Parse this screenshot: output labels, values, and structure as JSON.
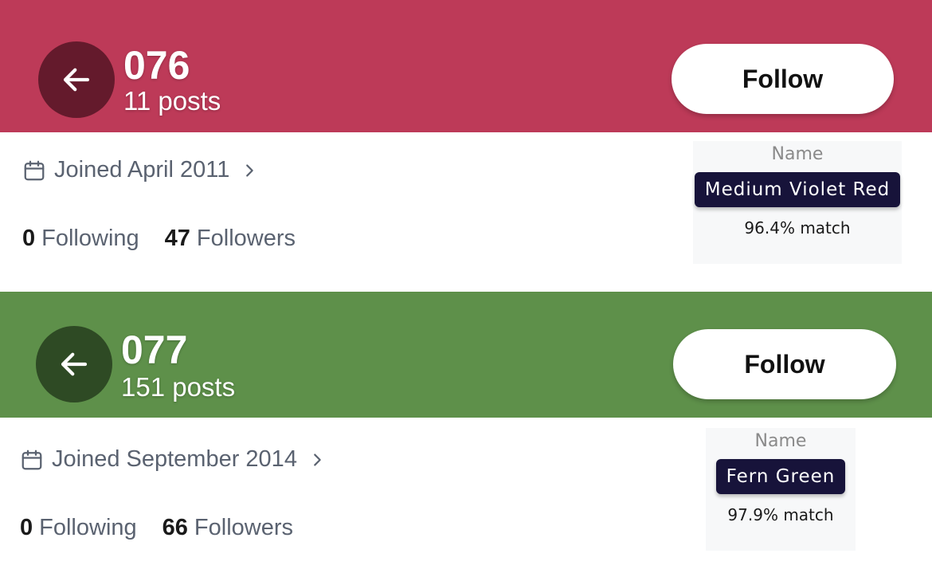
{
  "cards": [
    {
      "color": "#BD3A58",
      "back_color": "#641A2C",
      "handle": "076",
      "posts": "11 posts",
      "follow_label": "Follow",
      "joined": "Joined April 2011",
      "following_count": "0",
      "following_label": "Following",
      "followers_count": "47",
      "followers_label": "Followers",
      "name_label": "Name",
      "color_name": "Medium Violet Red",
      "match": "96.4% match"
    },
    {
      "color": "#5E904A",
      "back_color": "#2E4A24",
      "handle": "077",
      "posts": "151 posts",
      "follow_label": "Follow",
      "joined": "Joined September 2014",
      "following_count": "0",
      "following_label": "Following",
      "followers_count": "66",
      "followers_label": "Followers",
      "name_label": "Name",
      "color_name": "Fern Green",
      "match": "97.9% match"
    }
  ],
  "icons": {
    "back": "back-arrow-icon",
    "calendar": "calendar-icon",
    "chevron": "chevron-right-icon"
  }
}
